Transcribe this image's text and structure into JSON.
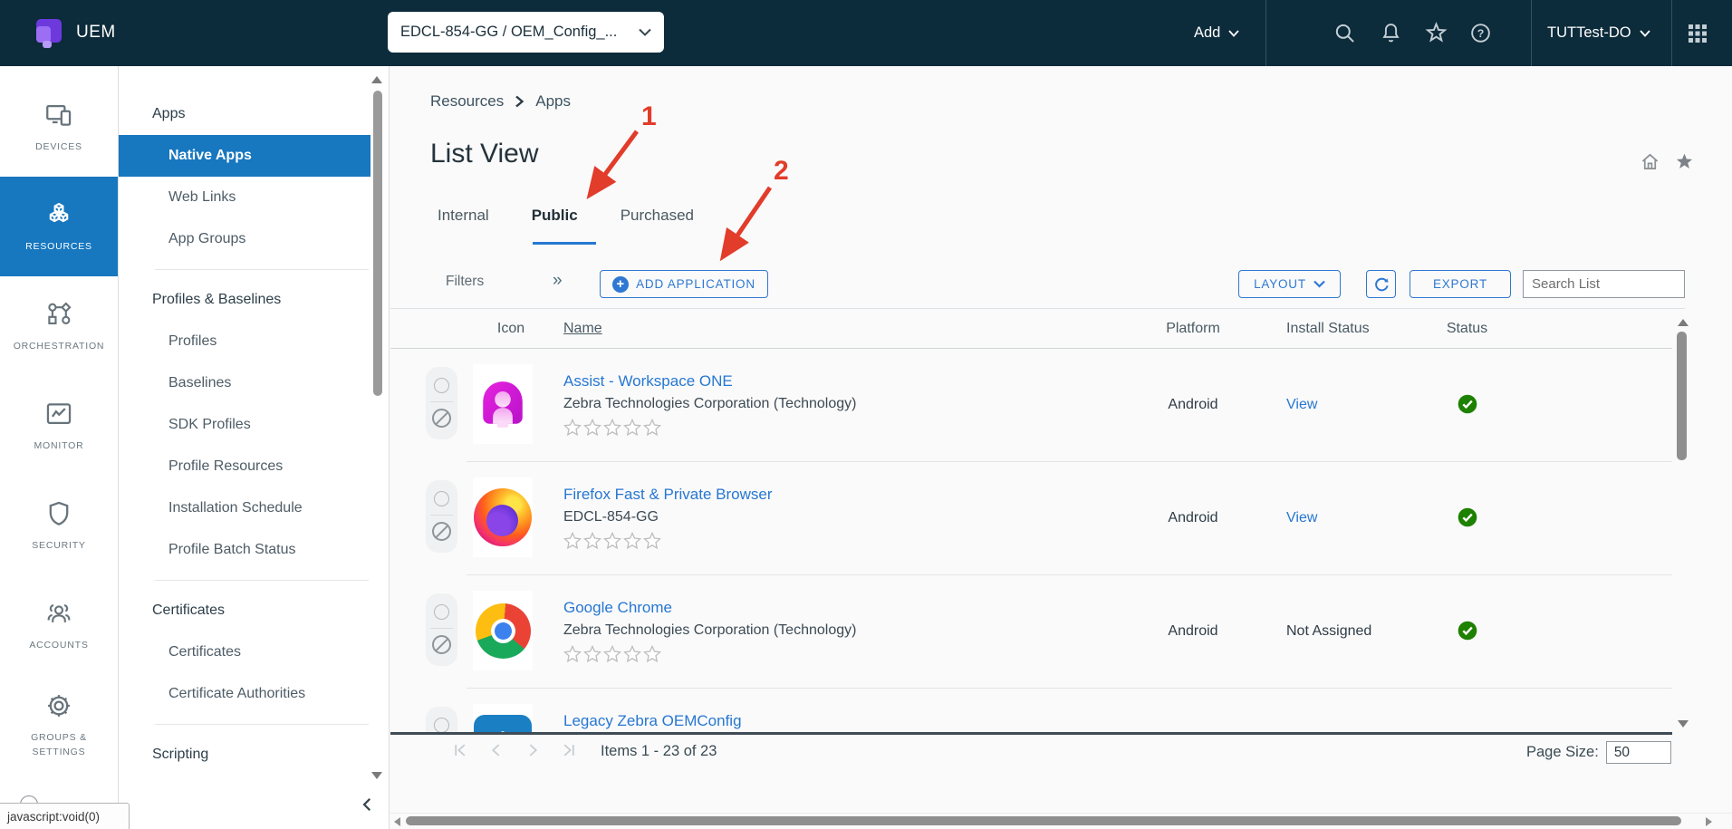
{
  "topbar": {
    "product_name": "UEM",
    "og_selector": "EDCL-854-GG / OEM_Config_...",
    "add_label": "Add",
    "account_name": "TUTTest-DO",
    "icon_names": [
      "search-icon",
      "notifications-icon",
      "favorites-icon",
      "help-icon",
      "app-switcher-icon"
    ]
  },
  "primary_nav": {
    "items": [
      {
        "label": "DEVICES",
        "icon": "devices-icon",
        "selected": false
      },
      {
        "label": "RESOURCES",
        "icon": "resources-icon",
        "selected": true
      },
      {
        "label": "ORCHESTRATION",
        "icon": "orchestration-icon",
        "selected": false
      },
      {
        "label": "MONITOR",
        "icon": "monitor-icon",
        "selected": false
      },
      {
        "label": "SECURITY",
        "icon": "security-icon",
        "selected": false
      },
      {
        "label": "ACCOUNTS",
        "icon": "accounts-icon",
        "selected": false
      },
      {
        "label": "GROUPS & SETTINGS",
        "label_line1": "GROUPS &",
        "label_line2": "SETTINGS",
        "icon": "settings-icon",
        "selected": false
      }
    ]
  },
  "secondary_nav": {
    "sections": [
      {
        "header": "Apps",
        "items": [
          {
            "label": "Native Apps",
            "selected": true
          },
          {
            "label": "Web Links",
            "selected": false
          },
          {
            "label": "App Groups",
            "selected": false
          }
        ]
      },
      {
        "header": "Profiles & Baselines",
        "items": [
          {
            "label": "Profiles",
            "selected": false
          },
          {
            "label": "Baselines",
            "selected": false
          },
          {
            "label": "SDK Profiles",
            "selected": false
          },
          {
            "label": "Profile Resources",
            "selected": false
          },
          {
            "label": "Installation Schedule",
            "selected": false
          },
          {
            "label": "Profile Batch Status",
            "selected": false
          }
        ]
      },
      {
        "header": "Certificates",
        "items": [
          {
            "label": "Certificates",
            "selected": false
          },
          {
            "label": "Certificate Authorities",
            "selected": false
          }
        ]
      },
      {
        "header": "Scripting",
        "items": []
      }
    ]
  },
  "main": {
    "breadcrumb": [
      "Resources",
      "Apps"
    ],
    "page_title": "List View",
    "tabs": [
      {
        "label": "Internal",
        "selected": false
      },
      {
        "label": "Public",
        "selected": true
      },
      {
        "label": "Purchased",
        "selected": false
      }
    ],
    "toolbar": {
      "filters_label": "Filters",
      "add_application_label": "ADD APPLICATION",
      "layout_label": "LAYOUT",
      "export_label": "EXPORT",
      "search_placeholder": "Search List"
    },
    "annotations": [
      {
        "label": "1"
      },
      {
        "label": "2"
      }
    ],
    "table": {
      "columns": [
        "Icon",
        "Name",
        "Platform",
        "Install Status",
        "Status"
      ],
      "rows": [
        {
          "name": "Assist - Workspace ONE",
          "subtitle": "Zebra Technologies Corporation (Technology)",
          "rating": 0,
          "platform": "Android",
          "install_status": "View",
          "install_status_is_link": true,
          "status": "approved",
          "icon": "workspace-one-assist-icon"
        },
        {
          "name": "Firefox Fast & Private Browser",
          "subtitle": "EDCL-854-GG",
          "rating": 0,
          "platform": "Android",
          "install_status": "View",
          "install_status_is_link": true,
          "status": "approved",
          "icon": "firefox-icon"
        },
        {
          "name": "Google Chrome",
          "subtitle": "Zebra Technologies Corporation (Technology)",
          "rating": 0,
          "platform": "Android",
          "install_status": "Not Assigned",
          "install_status_is_link": false,
          "status": "approved",
          "icon": "chrome-icon"
        },
        {
          "name": "Legacy Zebra OEMConfig",
          "icon": "zebra-oemconfig-icon"
        }
      ]
    },
    "footer": {
      "items_text": "Items 1 - 23 of 23",
      "page_size_label": "Page Size:",
      "page_size_value": "50"
    }
  },
  "status_bar": {
    "text": "javascript:void(0)"
  },
  "colors": {
    "topbar": "#0c2b3b",
    "nav_selected": "#1777bf",
    "link": "#2777d2",
    "success": "#1e8100",
    "annotation": "#e23c2a"
  }
}
